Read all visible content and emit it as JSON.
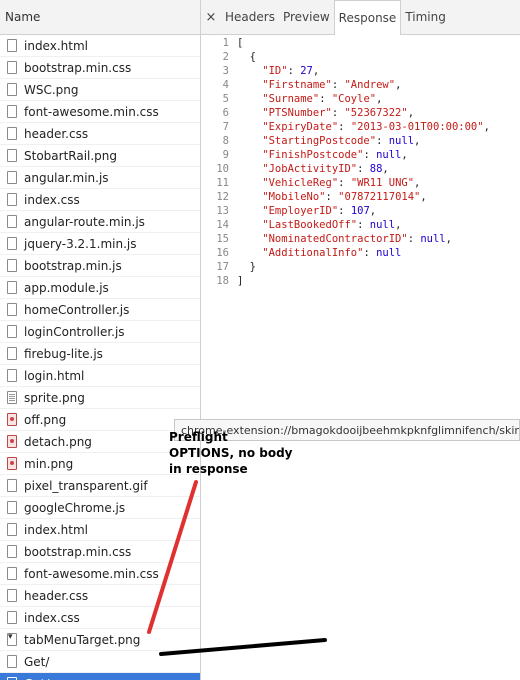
{
  "left_panel": {
    "header": "Name",
    "files": [
      {
        "name": "index.html",
        "icon": "document-icon"
      },
      {
        "name": "bootstrap.min.css",
        "icon": "document-icon"
      },
      {
        "name": "WSC.png",
        "icon": "document-icon"
      },
      {
        "name": "font-awesome.min.css",
        "icon": "document-icon"
      },
      {
        "name": "header.css",
        "icon": "document-icon"
      },
      {
        "name": "StobartRail.png",
        "icon": "document-icon"
      },
      {
        "name": "angular.min.js",
        "icon": "document-icon"
      },
      {
        "name": "index.css",
        "icon": "document-icon"
      },
      {
        "name": "angular-route.min.js",
        "icon": "document-icon"
      },
      {
        "name": "jquery-3.2.1.min.js",
        "icon": "document-icon"
      },
      {
        "name": "bootstrap.min.js",
        "icon": "document-icon"
      },
      {
        "name": "app.module.js",
        "icon": "document-icon"
      },
      {
        "name": "homeController.js",
        "icon": "document-icon"
      },
      {
        "name": "loginController.js",
        "icon": "document-icon"
      },
      {
        "name": "firebug-lite.js",
        "icon": "document-icon"
      },
      {
        "name": "login.html",
        "icon": "document-icon"
      },
      {
        "name": "sprite.png",
        "icon": "sprite-image-icon"
      },
      {
        "name": "off.png",
        "icon": "image-icon"
      },
      {
        "name": "detach.png",
        "icon": "image-icon"
      },
      {
        "name": "min.png",
        "icon": "image-icon"
      },
      {
        "name": "pixel_transparent.gif",
        "icon": "document-icon"
      },
      {
        "name": "googleChrome.js",
        "icon": "document-icon"
      },
      {
        "name": "index.html",
        "icon": "document-icon"
      },
      {
        "name": "bootstrap.min.css",
        "icon": "document-icon"
      },
      {
        "name": "font-awesome.min.css",
        "icon": "document-icon"
      },
      {
        "name": "header.css",
        "icon": "document-icon"
      },
      {
        "name": "index.css",
        "icon": "document-icon"
      },
      {
        "name": "tabMenuTarget.png",
        "icon": "dropdown-image-icon"
      },
      {
        "name": "Get/",
        "icon": "document-icon"
      },
      {
        "name": "Get/",
        "icon": "document-icon",
        "selected": true
      }
    ]
  },
  "tabs": {
    "close": "×",
    "items": [
      "Headers",
      "Preview",
      "Response",
      "Timing"
    ],
    "active": "Response"
  },
  "response_lines": [
    {
      "n": "1",
      "parts": [
        [
          "punc",
          "["
        ]
      ]
    },
    {
      "n": "2",
      "parts": [
        [
          "punc",
          "  {"
        ]
      ]
    },
    {
      "n": "3",
      "parts": [
        [
          "key",
          "    \"ID\""
        ],
        [
          "punc",
          ": "
        ],
        [
          "num",
          "27"
        ],
        [
          "punc",
          ","
        ]
      ]
    },
    {
      "n": "4",
      "parts": [
        [
          "key",
          "    \"Firstname\""
        ],
        [
          "punc",
          ": "
        ],
        [
          "str",
          "\"Andrew\""
        ],
        [
          "punc",
          ","
        ]
      ]
    },
    {
      "n": "5",
      "parts": [
        [
          "key",
          "    \"Surname\""
        ],
        [
          "punc",
          ": "
        ],
        [
          "str",
          "\"Coyle\""
        ],
        [
          "punc",
          ","
        ]
      ]
    },
    {
      "n": "6",
      "parts": [
        [
          "key",
          "    \"PTSNumber\""
        ],
        [
          "punc",
          ": "
        ],
        [
          "str",
          "\"52367322\""
        ],
        [
          "punc",
          ","
        ]
      ]
    },
    {
      "n": "7",
      "parts": [
        [
          "key",
          "    \"ExpiryDate\""
        ],
        [
          "punc",
          ": "
        ],
        [
          "str",
          "\"2013-03-01T00:00:00\""
        ],
        [
          "punc",
          ","
        ]
      ]
    },
    {
      "n": "8",
      "parts": [
        [
          "key",
          "    \"StartingPostcode\""
        ],
        [
          "punc",
          ": "
        ],
        [
          "nul",
          "null"
        ],
        [
          "punc",
          ","
        ]
      ]
    },
    {
      "n": "9",
      "parts": [
        [
          "key",
          "    \"FinishPostcode\""
        ],
        [
          "punc",
          ": "
        ],
        [
          "nul",
          "null"
        ],
        [
          "punc",
          ","
        ]
      ]
    },
    {
      "n": "10",
      "parts": [
        [
          "key",
          "    \"JobActivityID\""
        ],
        [
          "punc",
          ": "
        ],
        [
          "num",
          "88"
        ],
        [
          "punc",
          ","
        ]
      ]
    },
    {
      "n": "11",
      "parts": [
        [
          "key",
          "    \"VehicleReg\""
        ],
        [
          "punc",
          ": "
        ],
        [
          "str",
          "\"WR11 UNG\""
        ],
        [
          "punc",
          ","
        ]
      ]
    },
    {
      "n": "12",
      "parts": [
        [
          "key",
          "    \"MobileNo\""
        ],
        [
          "punc",
          ": "
        ],
        [
          "str",
          "\"07872117014\""
        ],
        [
          "punc",
          ","
        ]
      ]
    },
    {
      "n": "13",
      "parts": [
        [
          "key",
          "    \"EmployerID\""
        ],
        [
          "punc",
          ": "
        ],
        [
          "num",
          "107"
        ],
        [
          "punc",
          ","
        ]
      ]
    },
    {
      "n": "14",
      "parts": [
        [
          "key",
          "    \"LastBookedOff\""
        ],
        [
          "punc",
          ": "
        ],
        [
          "nul",
          "null"
        ],
        [
          "punc",
          ","
        ]
      ]
    },
    {
      "n": "15",
      "parts": [
        [
          "key",
          "    \"NominatedContractorID\""
        ],
        [
          "punc",
          ": "
        ],
        [
          "nul",
          "null"
        ],
        [
          "punc",
          ","
        ]
      ]
    },
    {
      "n": "16",
      "parts": [
        [
          "key",
          "    \"AdditionalInfo\""
        ],
        [
          "punc",
          ": "
        ],
        [
          "nul",
          "null"
        ]
      ]
    },
    {
      "n": "17",
      "parts": [
        [
          "punc",
          "  }"
        ]
      ]
    },
    {
      "n": "18",
      "parts": [
        [
          "punc",
          "]"
        ]
      ]
    }
  ],
  "tooltip": "chrome-extension://bmagokdooijbeehmkpknfglimnifench/skin/",
  "annotation": {
    "lines": [
      "Preflight",
      "OPTIONS, no body",
      "in response"
    ],
    "color": "#000000",
    "arrow_color": "#e03030",
    "underline_color": "#000000"
  }
}
